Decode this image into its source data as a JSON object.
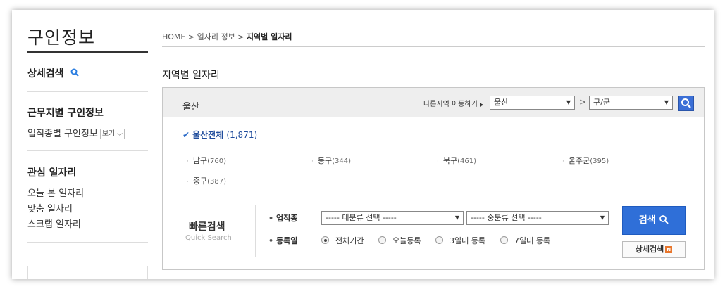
{
  "sidebar": {
    "title": "구인정보",
    "detail_search": "상세검색",
    "by_location": "근무지별 구인정보",
    "by_job": "업직종별 구인정보",
    "view_select": "보기",
    "interest_title": "관심 일자리",
    "links": [
      "오늘 본 일자리",
      "맞춤 일자리",
      "스크랩 일자리"
    ]
  },
  "breadcrumb": {
    "home": "HOME",
    "sep": ">",
    "level1": "일자리 정보",
    "current": "지역별 일자리"
  },
  "page_title": "지역별 일자리",
  "region_panel": {
    "region": "울산",
    "move_label": "다른지역 이동하기",
    "region_select": "울산",
    "district_select": "구/군",
    "separator": ">",
    "all": {
      "label": "울산전체",
      "count": "(1,871)"
    },
    "districts": [
      {
        "name": "남구",
        "count": "(760)"
      },
      {
        "name": "동구",
        "count": "(344)"
      },
      {
        "name": "북구",
        "count": "(461)"
      },
      {
        "name": "울주군",
        "count": "(395)"
      },
      {
        "name": "중구",
        "count": "(387)"
      }
    ]
  },
  "quick_search": {
    "title": "빠른검색",
    "subtitle": "Quick Search",
    "job_label": "업직종",
    "major_select": "----- 대분류 선택 -----",
    "minor_select": "----- 중분류 선택 -----",
    "date_label": "등록일",
    "date_options": [
      "전체기간",
      "오늘등록",
      "3일내 등록",
      "7일내 등록"
    ],
    "date_selected": "전체기간",
    "search_button": "검색",
    "detail_button": "상세검색",
    "detail_badge": "N"
  },
  "colors": {
    "accent": "#2f6fd8",
    "link_blue": "#1f4c9c",
    "panel_head": "#eeeeee"
  }
}
